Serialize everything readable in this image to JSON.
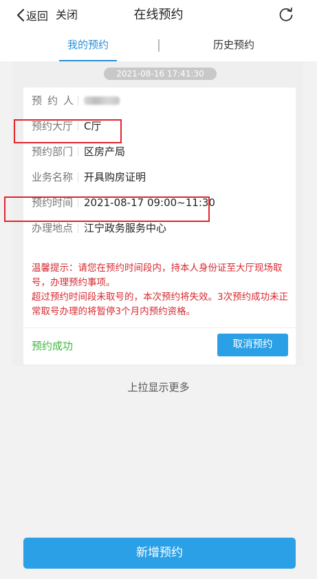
{
  "nav": {
    "back_label": "返回",
    "close_label": "关闭",
    "title": "在线预约"
  },
  "tabs": [
    {
      "label": "我的预约",
      "active": true
    },
    {
      "label": "历史预约",
      "active": false
    }
  ],
  "timestamp": "2021-08-16 17:41:30",
  "card": {
    "rows": [
      {
        "label": "预约人",
        "value": ""
      },
      {
        "label": "预约大厅",
        "value": "C厅"
      },
      {
        "label": "预约部门",
        "value": "区房产局"
      },
      {
        "label": "业务名称",
        "value": "开具购房证明"
      },
      {
        "label": "预约时间",
        "value": "2021-08-17 09:00~11:30"
      },
      {
        "label": "办理地点",
        "value": "江宁政务服务中心"
      }
    ],
    "notice_lines": [
      "温馨提示：请您在预约时间段内，持本人身份证至大厅现场取号，办理预约事项。",
      "超过预约时间段未取号的，本次预约将失效。3次预约成功未正常取号办理的将暂停3个月内预约资格。"
    ],
    "status": "预约成功",
    "cancel_label": "取消预约"
  },
  "pull_more_label": "上拉显示更多",
  "new_button_label": "新增预约",
  "colors": {
    "accent": "#2ba0e6",
    "tab_active": "#2a8fd8",
    "notice": "#d7282f",
    "success": "#3cb83c",
    "highlight_box": "#e0242b"
  },
  "icons": {
    "back": "chevron-left-icon",
    "refresh": "refresh-icon"
  }
}
